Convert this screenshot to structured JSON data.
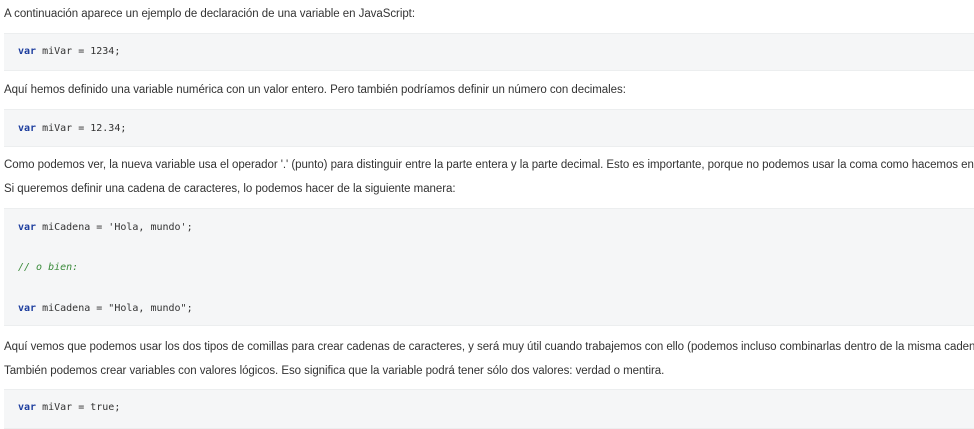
{
  "paragraphs": {
    "p1": "A continuación aparece un ejemplo de declaración de una variable en JavaScript:",
    "p2": "Aquí hemos definido una variable numérica con un valor entero. Pero también podríamos definir un número con decimales:",
    "p3": "Como podemos ver, la nueva variable usa el operador '.' (punto) para distinguir entre la parte entera y la parte decimal. Esto es importante, porque no podemos usar la coma como hacemos en España.",
    "p4": "Si queremos definir una cadena de caracteres, lo podemos hacer de la siguiente manera:",
    "p5": "Aquí vemos que podemos usar los dos tipos de comillas para crear cadenas de caracteres, y será muy útil cuando trabajemos con ello (podemos incluso combinarlas dentro de la misma cadena).",
    "p6": "También podemos crear variables con valores lógicos. Eso significa que la variable podrá tener sólo dos valores: verdad o mentira."
  },
  "code": {
    "block1": {
      "line1": {
        "keyword": "var",
        "rest": " miVar = 1234;"
      }
    },
    "block2": {
      "line1": {
        "keyword": "var",
        "rest": " miVar = 12.34;"
      }
    },
    "block3": {
      "line1": {
        "keyword": "var",
        "rest": " miCadena = 'Hola, mundo';"
      },
      "comment": "// o bien:",
      "line2": {
        "keyword": "var",
        "rest": " miCadena = \"Hola, mundo\";"
      }
    },
    "block4": {
      "line1": {
        "keyword": "var",
        "rest": " miVar = true;"
      }
    }
  },
  "colors": {
    "keyword": "#1f3f9f",
    "comment": "#3a8a3a",
    "code_background": "#f5f6f7",
    "text": "#333333"
  }
}
